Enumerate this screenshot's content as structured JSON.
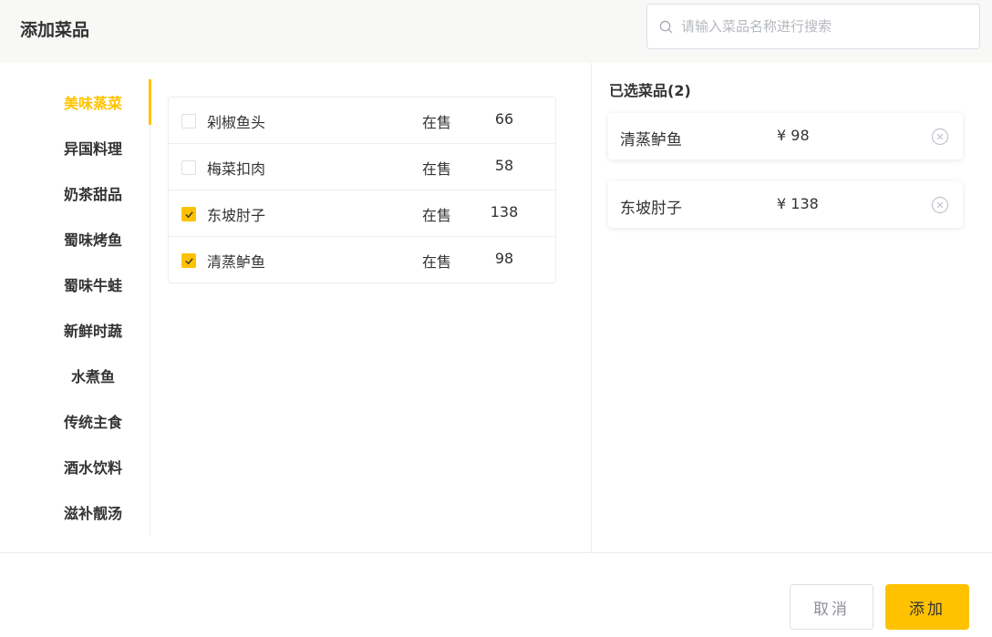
{
  "dialog": {
    "title": "添加菜品"
  },
  "search": {
    "placeholder": "请输入菜品名称进行搜索",
    "value": ""
  },
  "categories": [
    {
      "label": "美味蒸菜",
      "active": true
    },
    {
      "label": "异国料理",
      "active": false
    },
    {
      "label": "奶茶甜品",
      "active": false
    },
    {
      "label": "蜀味烤鱼",
      "active": false
    },
    {
      "label": "蜀味牛蛙",
      "active": false
    },
    {
      "label": "新鲜时蔬",
      "active": false
    },
    {
      "label": "水煮鱼",
      "active": false
    },
    {
      "label": "传统主食",
      "active": false
    },
    {
      "label": "酒水饮料",
      "active": false
    },
    {
      "label": "滋补靓汤",
      "active": false
    }
  ],
  "dishes": [
    {
      "name": "剁椒鱼头",
      "status": "在售",
      "price": "66",
      "checked": false
    },
    {
      "name": "梅菜扣肉",
      "status": "在售",
      "price": "58",
      "checked": false
    },
    {
      "name": "东坡肘子",
      "status": "在售",
      "price": "138",
      "checked": true
    },
    {
      "name": "清蒸鲈鱼",
      "status": "在售",
      "price": "98",
      "checked": true
    }
  ],
  "selected": {
    "title": "已选菜品(2)",
    "items": [
      {
        "name": "清蒸鲈鱼",
        "price": "¥  98"
      },
      {
        "name": "东坡肘子",
        "price": "¥  138"
      }
    ]
  },
  "footer": {
    "cancel_label": "取消",
    "add_label": "添加"
  },
  "colors": {
    "accent": "#ffc200",
    "text": "#333333",
    "muted": "#8d9098",
    "border": "#dcdfe6"
  },
  "icons": {
    "search": "search-icon",
    "check": "check-icon",
    "remove": "close-circle-icon"
  }
}
